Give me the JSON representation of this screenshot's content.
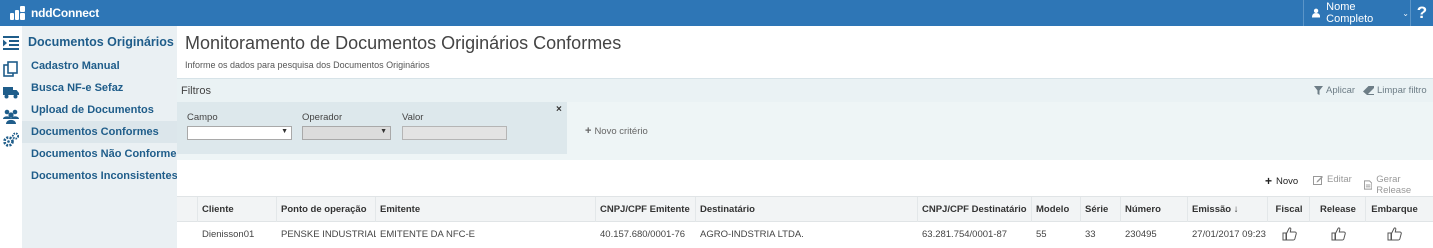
{
  "app": {
    "brand": "nddConnect",
    "user_name": "Nome Completo",
    "help": "?"
  },
  "sidebar": {
    "title": "Documentos Originários",
    "items": [
      {
        "label": "Cadastro Manual"
      },
      {
        "label": "Busca NF-e Sefaz"
      },
      {
        "label": "Upload de Documentos"
      },
      {
        "label": "Documentos Conformes",
        "active": true
      },
      {
        "label": "Documentos Não Conformes"
      },
      {
        "label": "Documentos Inconsistentes"
      }
    ]
  },
  "page": {
    "title": "Monitoramento de Documentos Originários Conformes",
    "subtitle": "Informe os dados para pesquisa dos Documentos Originários"
  },
  "filters": {
    "label": "Filtros",
    "apply_label": "Aplicar",
    "clear_label": "Limpar filtro",
    "close_symbol": "×",
    "field_label": "Campo",
    "operator_label": "Operador",
    "value_label": "Valor",
    "new_criterio_label": "Novo critério"
  },
  "toolbar": {
    "novo_label": "Novo",
    "editar_label": "Editar",
    "gerar_release_label": "Gerar Release"
  },
  "table": {
    "columns": [
      "Cliente",
      "Ponto de operação",
      "Emitente",
      "CNPJ/CPF Emitente",
      "Destinatário",
      "CNPJ/CPF Destinatário",
      "Modelo",
      "Série",
      "Número",
      "Emissão ↓",
      "Fiscal",
      "Release",
      "Embarque"
    ],
    "rows": [
      {
        "cliente": "Dienisson01",
        "ponto": "PENSKE INDUSTRIAL",
        "emitente": "EMITENTE DA NFC-E",
        "cnpj_emitente": "40.157.680/0001-76",
        "destinatario": "AGRO-INDSTRIA LTDA.",
        "cnpj_destinatario": "63.281.754/0001-87",
        "modelo": "55",
        "serie": "33",
        "numero": "230495",
        "emissao": "27/01/2017 09:23"
      }
    ]
  },
  "colors": {
    "topbar": "#2e76b6",
    "nav_text": "#1f5d8a",
    "sidebar_bg": "#eaf0f3"
  }
}
